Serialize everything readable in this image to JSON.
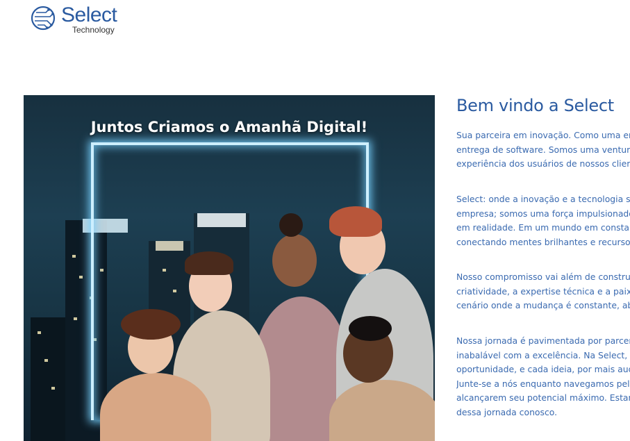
{
  "header": {
    "logo_word": "Select",
    "logo_sub": "Technology"
  },
  "hero": {
    "title": "Juntos Criamos o Amanhã Digital!"
  },
  "main": {
    "heading": "Bem vindo a Select",
    "paragraphs": [
      [
        "Sua parceira em inovação. Como uma em",
        "entrega de software. Somos uma venture",
        "experiência dos usuários de nossos client"
      ],
      [
        "Select: onde a inovação e a tecnologia se",
        "empresa; somos uma força impulsionado",
        "em realidade. Em um mundo em constan",
        "conectando mentes brilhantes e recursos"
      ],
      [
        "Nosso compromisso vai além de construi",
        "criatividade, a expertise técnica e a paixã",
        "cenário onde a mudança é constante, abr"
      ],
      [
        "Nossa jornada é pavimentada por parcer",
        "inabalável com a excelência. Na Select, ac",
        "oportunidade, e cada ideia, por mais aud",
        "Junte-se a nós enquanto navegamos pela",
        "alcançarem seu potencial máximo. Estam",
        "dessa jornada conosco."
      ]
    ]
  },
  "colors": {
    "brand_blue": "#2a5aa0",
    "text_blue": "#3a6ab0",
    "neon": "#cdefff"
  },
  "icons": {
    "logo": "circuit-globe-icon"
  }
}
